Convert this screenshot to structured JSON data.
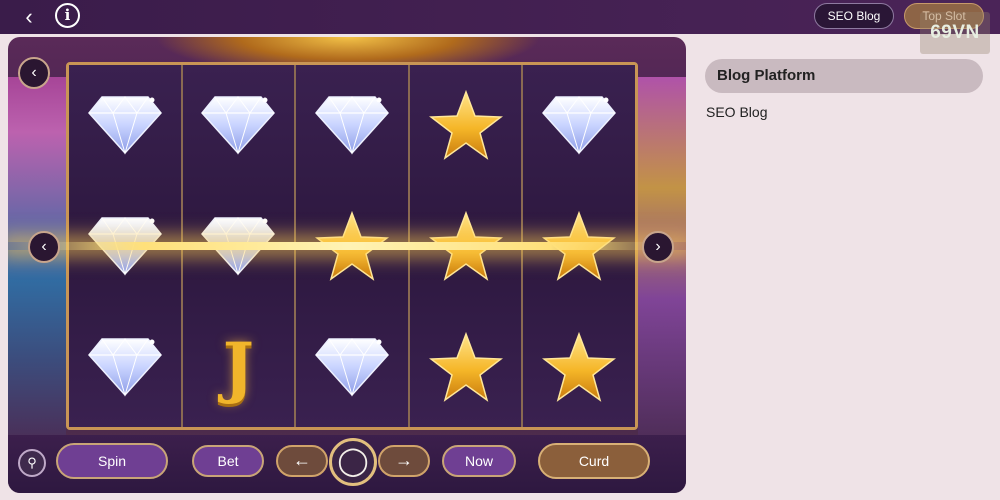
{
  "topbar": {
    "back_icon": "chevron-left-icon",
    "info_label": "i",
    "seo_blog_label": "SEO Blog",
    "top_slot_label": "Top Slot",
    "logo_text": "69VN"
  },
  "game": {
    "reels": [
      [
        "diamond",
        "diamond",
        "diamond"
      ],
      [
        "diamond",
        "diamond",
        "J"
      ],
      [
        "diamond",
        "star",
        "diamond"
      ],
      [
        "star",
        "star",
        "star"
      ],
      [
        "diamond",
        "star",
        "star"
      ]
    ],
    "nav_top_label": "‹",
    "nav_left_label": "‹",
    "nav_right_label": "›",
    "payline_color": "#ffe07a"
  },
  "controls": {
    "home_icon": "home-icon",
    "spin_label": "Spin",
    "bet_label": "Bet",
    "left_arrow": "←",
    "ring_icon": "spin-ring-icon",
    "right_arrow": "→",
    "now_label": "Now",
    "curd_label": "Curd"
  },
  "panel": {
    "title": "Blog Platform",
    "link": "SEO Blog"
  }
}
